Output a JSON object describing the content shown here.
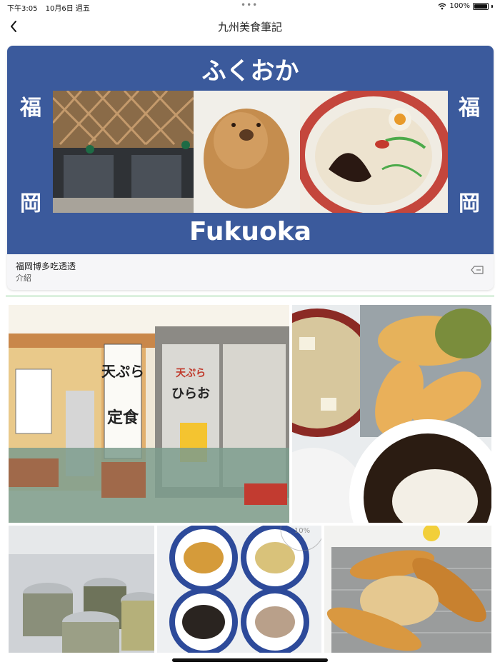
{
  "status_bar": {
    "time": "下午3:05",
    "date": "10月6日 週五",
    "battery": "100%"
  },
  "nav": {
    "title": "九州美食筆記"
  },
  "card": {
    "banner": {
      "top_text": "ふくおか",
      "bottom_text": "Fukuoka",
      "left_chars": [
        "福",
        "岡"
      ],
      "right_chars": [
        "福",
        "岡"
      ],
      "background": "#3b5a9c"
    },
    "title": "福岡博多吃透透",
    "subtitle": "介紹"
  },
  "photos": {
    "tempura_sign_lines": [
      "天ぷら",
      "定食"
    ],
    "tempura_shop_name": [
      "天ぷら",
      "ひらお"
    ],
    "watermark": "10%"
  },
  "icons": [
    "chevron-left-icon",
    "wifi-icon",
    "battery-icon",
    "tag-icon"
  ],
  "colors": {
    "divider": "#7ecb8a",
    "banner": "#3b5a9c"
  }
}
